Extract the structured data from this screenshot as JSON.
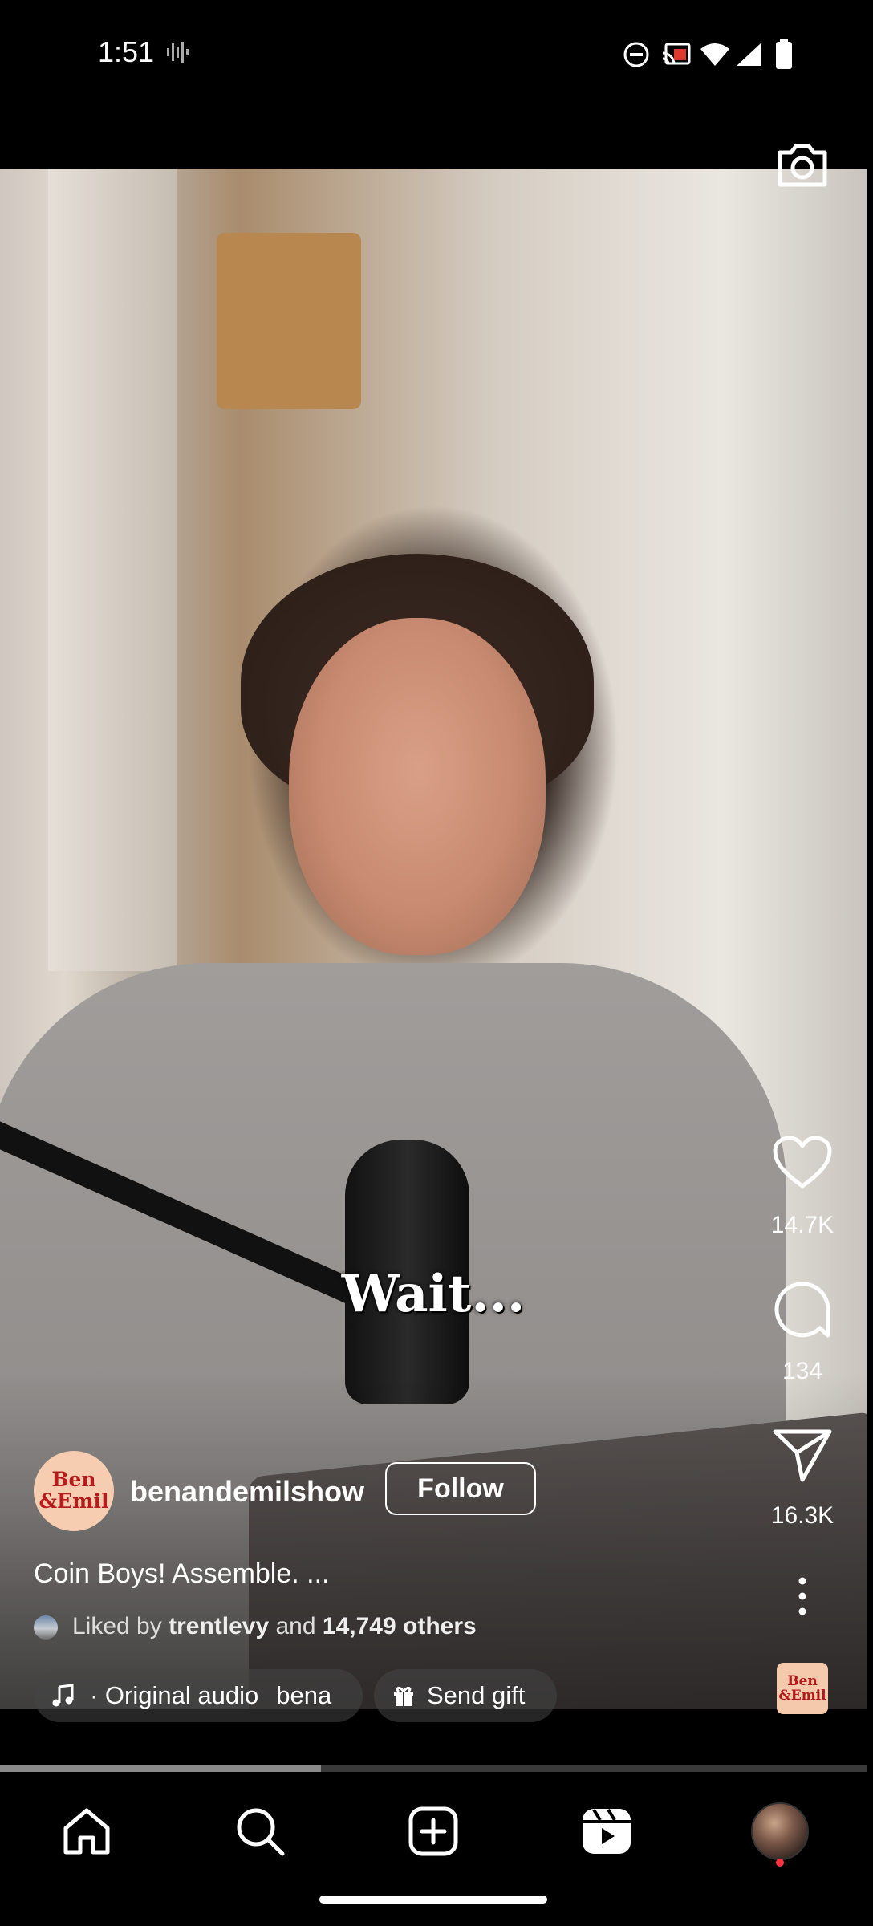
{
  "status_bar": {
    "time": "1:51",
    "icons": [
      "voicemail-icon",
      "do-not-disturb-icon",
      "cast-icon",
      "wifi-icon",
      "signal-icon",
      "battery-icon"
    ]
  },
  "video": {
    "caption_overlay": "Wait..."
  },
  "right_rail": {
    "camera_icon": "camera-icon",
    "like_count": "14.7K",
    "comment_count": "134",
    "share_count": "16.3K",
    "audio_thumb_text": "Ben &Emil"
  },
  "author": {
    "avatar_text": "Ben &Emil",
    "username": "benandemilshow",
    "follow_label": "Follow"
  },
  "post": {
    "caption": "Coin Boys! Assemble. ...",
    "liked_prefix": "Liked by",
    "liked_user": "trentlevy",
    "liked_and": "and",
    "liked_others": "14,749 others"
  },
  "audio": {
    "label": "· Original audio",
    "scrolling_name": "bena"
  },
  "gift": {
    "label": "Send gift"
  },
  "progress": {
    "fraction": 0.37
  },
  "nav": {
    "items": [
      "home-icon",
      "search-icon",
      "create-icon",
      "reels-icon",
      "profile-avatar"
    ],
    "profile_notification_color": "#ff3040"
  },
  "colors": {
    "background": "#000000",
    "text": "#ffffff",
    "brand_red": "#b71c1c"
  }
}
